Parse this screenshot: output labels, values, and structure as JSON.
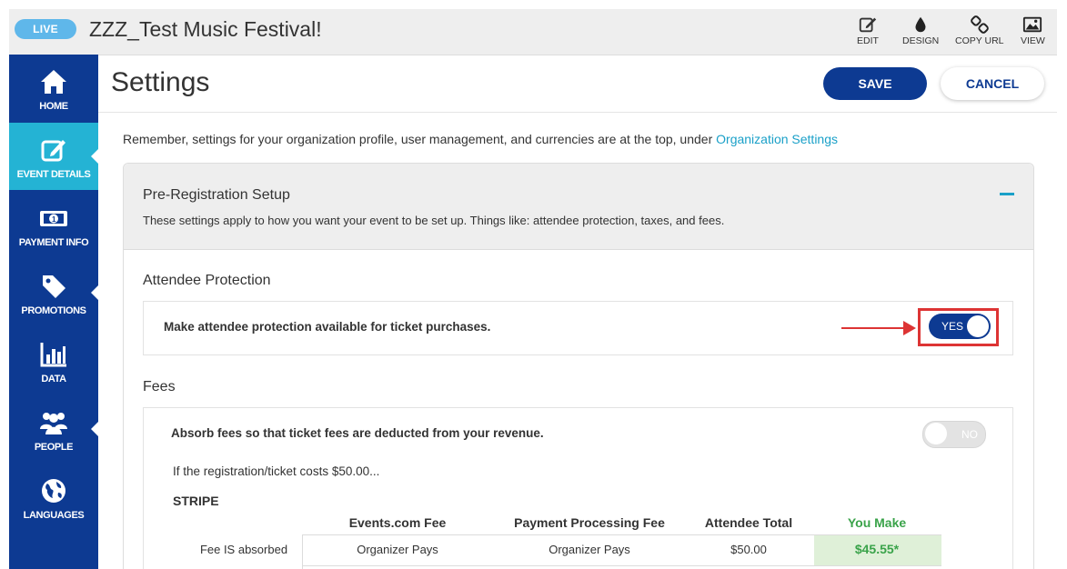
{
  "topbar": {
    "status": "LIVE",
    "event_title": "ZZZ_Test Music Festival!",
    "tools": [
      {
        "label": "EDIT",
        "icon": "edit-icon"
      },
      {
        "label": "DESIGN",
        "icon": "droplet-icon"
      },
      {
        "label": "COPY URL",
        "icon": "link-icon"
      },
      {
        "label": "VIEW",
        "icon": "image-icon"
      }
    ]
  },
  "sidebar": {
    "items": [
      {
        "label": "HOME",
        "icon": "home-icon"
      },
      {
        "label": "EVENT DETAILS",
        "icon": "edit-icon",
        "active": true
      },
      {
        "label": "PAYMENT INFO",
        "icon": "money-icon"
      },
      {
        "label": "PROMOTIONS",
        "icon": "tag-icon"
      },
      {
        "label": "DATA",
        "icon": "bar-chart-icon"
      },
      {
        "label": "PEOPLE",
        "icon": "people-icon"
      },
      {
        "label": "LANGUAGES",
        "icon": "globe-icon"
      }
    ]
  },
  "header": {
    "title": "Settings",
    "save_label": "SAVE",
    "cancel_label": "CANCEL"
  },
  "notice": {
    "text": "Remember, settings for your organization profile, user management, and currencies are at the top, under ",
    "link": "Organization Settings"
  },
  "section": {
    "title": "Pre-Registration Setup",
    "description": "These settings apply to how you want your event to be set up. Things like: attendee protection, taxes, and fees.",
    "attendee_protection": {
      "label": "Attendee Protection",
      "row_text": "Make attendee protection available for ticket purchases.",
      "toggle_label": "YES",
      "toggle_on": true
    },
    "fees": {
      "label": "Fees",
      "row_text": "Absorb fees so that ticket fees are deducted from your revenue.",
      "toggle_label": "NO",
      "toggle_on": false,
      "example_text": "If the registration/ticket costs $50.00...",
      "processor": "STRIPE",
      "table": {
        "headers": [
          "Events.com Fee",
          "Payment Processing Fee",
          "Attendee Total",
          "You Make"
        ],
        "rows": [
          {
            "label": "Fee IS absorbed",
            "cells": [
              "Organizer Pays",
              "Organizer Pays",
              "$50.00",
              "$45.55*"
            ]
          }
        ]
      }
    }
  },
  "colors": {
    "brand_navy": "#0d3a92",
    "accent_cyan": "#24b3d4",
    "link": "#1aa0c8",
    "you_make_green": "#3aa34a",
    "annotation_red": "#dd3434"
  }
}
